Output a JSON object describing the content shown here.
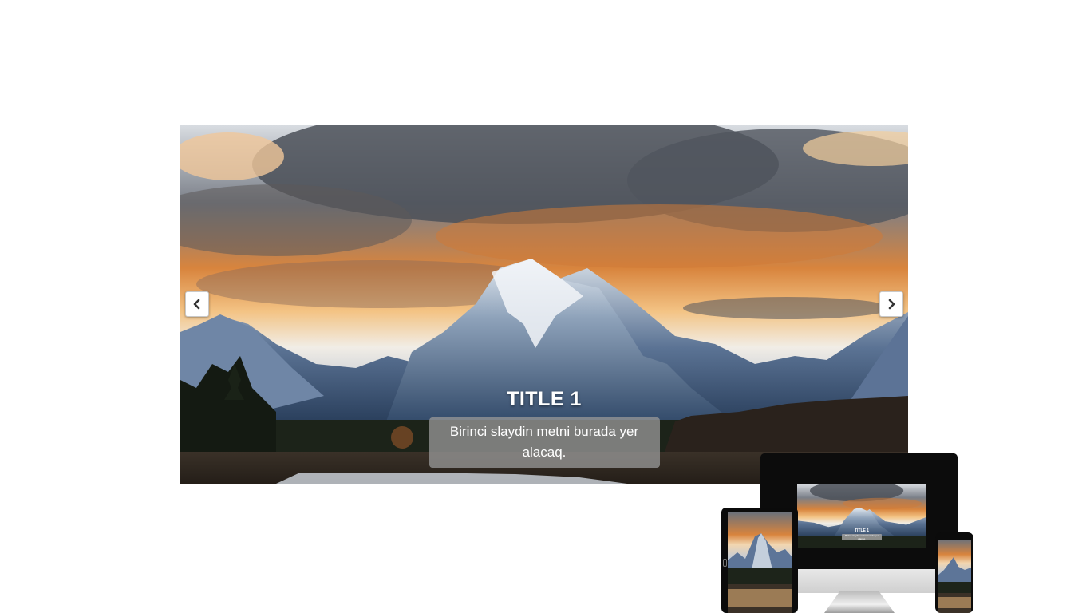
{
  "slider": {
    "slides": [
      {
        "title": "TITLE 1",
        "text": "Birinci slaydin metni burada yer alacaq."
      }
    ],
    "active_index": 0,
    "prev_icon": "chevron-left-icon",
    "next_icon": "chevron-right-icon"
  },
  "devices_preview": {
    "title": "TITLE 1",
    "text": "Birinci slaydin metni burada yer alacaq."
  },
  "colors": {
    "background": "#ffffff",
    "caption_box": "#969696",
    "caption_text": "#ffffff"
  }
}
